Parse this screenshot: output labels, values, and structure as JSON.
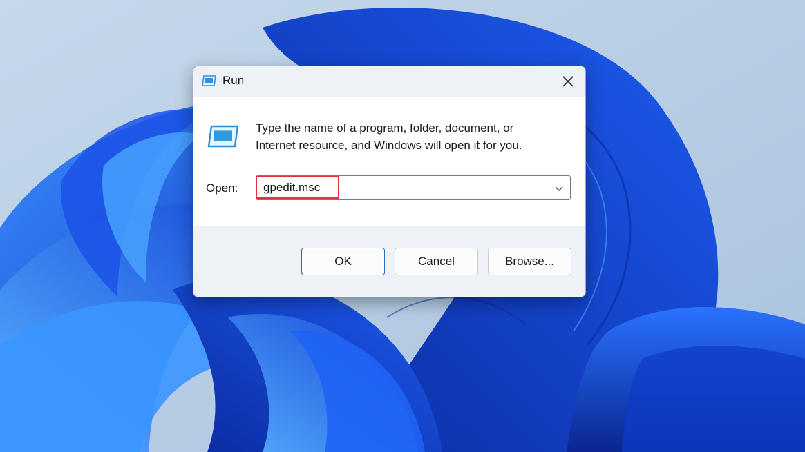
{
  "window": {
    "title": "Run",
    "description_line1": "Type the name of a program, folder, document, or",
    "description_line2": "Internet resource, and Windows will open it for you.",
    "open_label_accel": "O",
    "open_label_rest": "pen:",
    "command_value": "gpedit.msc"
  },
  "buttons": {
    "ok": "OK",
    "cancel": "Cancel",
    "browse_accel": "B",
    "browse_rest": "rowse..."
  },
  "icons": {
    "title": "run-icon",
    "main": "run-icon",
    "close": "close-icon",
    "dropdown": "chevron-down-icon"
  },
  "colors": {
    "accent": "#2b6cc4",
    "highlight": "#e0333b",
    "wallpaper": "#1a56e0"
  }
}
